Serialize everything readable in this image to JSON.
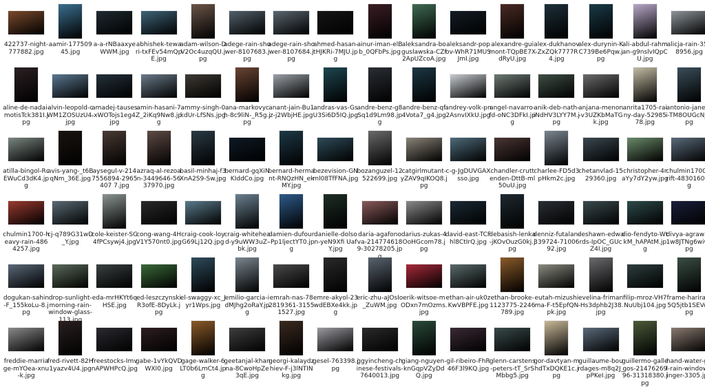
{
  "files": [
    {
      "name": "422737-night-777882.jpg",
      "color": "#7a4a2c",
      "shape": "landscape"
    },
    {
      "name": "aamir-17750945.jpg",
      "color": "#3b6e8e",
      "shape": "portrait"
    },
    {
      "name": "a-a-rNBaaxyeWWM.jpg",
      "color": "#1f2a30",
      "shape": "landscape"
    },
    {
      "name": "abhishek-tewari-txFEv54mQpE.jpg",
      "color": "#3e6478",
      "shape": "landscape"
    },
    {
      "name": "adam-wilson-DV2Oc4uzqQU.jpg",
      "color": "#6a5548",
      "shape": "portrait"
    },
    {
      "name": "adege-rain-shower-8107683.jpg",
      "color": "#52606a",
      "shape": "landscape"
    },
    {
      "name": "adege-rain-shower-8107684.jpg",
      "color": "#5a6670",
      "shape": "landscape"
    },
    {
      "name": "ahmed-hasan-tHJKRi-7MJU.jpg",
      "color": "#151515",
      "shape": "landscape"
    },
    {
      "name": "ainur-iman-elBb_0QFbPs.jpg",
      "color": "#3a1e24",
      "shape": "portrait"
    },
    {
      "name": "aleksandra-boguslawska-CZf2ApUZcoA.jpg",
      "color": "#3f6a52",
      "shape": "portrait"
    },
    {
      "name": "aleksandr-popov-WhR71MUSJmI.jpg",
      "color": "#141c24",
      "shape": "landscape"
    },
    {
      "name": "alexandre-guimont-TQpBE7XdRyU.jpg",
      "color": "#4a2a24",
      "shape": "portrait"
    },
    {
      "name": "alex-dukhanov-ZxZQk7777R4.jpg",
      "color": "#1e2f3a",
      "shape": "portrait"
    },
    {
      "name": "alex-durynin-KC739Be6Pqw.jpg",
      "color": "#1a3a46",
      "shape": "portrait"
    },
    {
      "name": "ali-abdul-rahman-g9nslvIQpCU.jpg",
      "color": "#b8a8c8",
      "shape": "portrait"
    },
    {
      "name": "alicja-rain-3518956.jpg",
      "color": "#8e949a",
      "shape": "landscape"
    },
    {
      "name": "aline-de-nadai-motisTck381I.jpg",
      "color": "#2a2022",
      "shape": "portrait"
    },
    {
      "name": "alvin-leopold-cWM1ZOSUzU4.jpg",
      "color": "#5a7890",
      "shape": "landscape"
    },
    {
      "name": "amadej-tauses-xWOTojs1eg4.jpg",
      "color": "#24303a",
      "shape": "landscape"
    },
    {
      "name": "amin-hasani-7Z_2iKq9Nw8.jpg",
      "color": "#6a7a88",
      "shape": "landscape"
    },
    {
      "name": "ammy-singh-0kdUr-LfSNs.jpg",
      "color": "#3e3a34",
      "shape": "landscape"
    },
    {
      "name": "ana-markovych-8c9liN-_R5g.jpg",
      "color": "#6a4432",
      "shape": "portrait"
    },
    {
      "name": "anant-jain-Bu1z-j2WbjHE.jpg",
      "color": "#9aa0a6",
      "shape": "landscape"
    },
    {
      "name": "andras-vas-GsU3Si6D5IQ.jpg",
      "color": "#1e4650",
      "shape": "portrait"
    },
    {
      "name": "andre-benz-g8Sq1d9Lm98.jpg",
      "color": "#2a2e34",
      "shape": "portrait"
    },
    {
      "name": "andre-benz-qf4Vota7_g4.jpg",
      "color": "#1c3844",
      "shape": "portrait"
    },
    {
      "name": "andrey-volk-pn2AsnvIXkU.jpg",
      "color": "#c8ccd0",
      "shape": "landscape"
    },
    {
      "name": "angel-navarro-fd-oNC3DFkI.jpg",
      "color": "#6e7a74",
      "shape": "landscape"
    },
    {
      "name": "anik-deb-nath-iNdHV3LYY7M.jpg",
      "color": "#3e4e44",
      "shape": "landscape"
    },
    {
      "name": "anjana-menon-v3UZKbMaTGk.jpg",
      "color": "#6c6a6a",
      "shape": "landscape"
    },
    {
      "name": "anrita1705-rainy-day-5298578.jpg",
      "color": "#c4bca4",
      "shape": "portrait"
    },
    {
      "name": "antonio-janeski-TM8OUGcNjY.jpg",
      "color": "#3a4e5a",
      "shape": "portrait"
    },
    {
      "name": "atilla-bingol-RcEWuCd3dK4.jpg",
      "color": "#7a8680",
      "shape": "landscape"
    },
    {
      "name": "avis-yang-_t6BqNm_36E.jpg",
      "color": "#1a1410",
      "shape": "portrait"
    },
    {
      "name": "aysegul-v-2147556894-2965407 7.jpg",
      "color": "#4a3a34",
      "shape": "portrait"
    },
    {
      "name": "azraq-al-rezoan-3449646-5637970.jpg",
      "color": "#5e4a44",
      "shape": "portrait"
    },
    {
      "name": "basil-minhaj-f3XnA2S9-Sw.jpg",
      "color": "#2a3a44",
      "shape": "portrait"
    },
    {
      "name": "bernard-gqXiNKIddCo.jpg",
      "color": "#0e1a24",
      "shape": "landscape"
    },
    {
      "name": "bernard-hermant-RNQzHN_ekMY.jpg",
      "color": "#1e3846",
      "shape": "portrait"
    },
    {
      "name": "bezevision-GNml08TfFNA.jpg",
      "color": "#2e4a58",
      "shape": "landscape"
    },
    {
      "name": "bozanguzel-12522699.jpg",
      "color": "#6a6a6a",
      "shape": "portrait"
    },
    {
      "name": "catgirlmutant-yZAV9qIKOQ8.jpg",
      "color": "#8a8478",
      "shape": "landscape"
    },
    {
      "name": "c-g-JgDUVGAXsso.jpg",
      "color": "#4e6a7a",
      "shape": "landscape"
    },
    {
      "name": "chandler-cruttenden-DttB-ml50uU.jpg",
      "color": "#4a3634",
      "shape": "landscape"
    },
    {
      "name": "charlee-FD5d3pHkm2c.jpg",
      "color": "#7a8690",
      "shape": "portrait"
    },
    {
      "name": "chetanvlad-1529360.jpg",
      "color": "#3a4850",
      "shape": "landscape"
    },
    {
      "name": "christopher-4raYy7dY2yw.jpg",
      "color": "#6a8a6a",
      "shape": "landscape"
    },
    {
      "name": "chulmin1700-drift-4830160.jpg",
      "color": "#5a6a7a",
      "shape": "landscape"
    },
    {
      "name": "chulmin1700-heavy-rain-4864257.jpg",
      "color": "#9a3a30",
      "shape": "landscape"
    },
    {
      "name": "cj-q789G31wD_Y.jpg",
      "color": "#5a6a74",
      "shape": "landscape"
    },
    {
      "name": "cole-keister-SG4fPCsywj4.jpg",
      "color": "#8a9490",
      "shape": "portrait"
    },
    {
      "name": "cong-wang-4HV1Y570nt0.jpg",
      "color": "#2a2a2a",
      "shape": "landscape"
    },
    {
      "name": "craig-cook-loyG69Lj12Q.jpg",
      "color": "#5a7a8a",
      "shape": "landscape"
    },
    {
      "name": "craig-whitehead-y9uWW3uZ-bk.jpg",
      "color": "#6a8090",
      "shape": "portrait"
    },
    {
      "name": "damien-dufour-Pp1ljectYT0.jpg",
      "color": "#2e5a88",
      "shape": "portrait"
    },
    {
      "name": "danielle-dolson-yeN9Xfi UafY.jpg",
      "color": "#1e2e26",
      "shape": "portrait"
    },
    {
      "name": "daria-agafonova-2147746189-30278205.jpg",
      "color": "#8a5a5a",
      "shape": "landscape"
    },
    {
      "name": "darius-zukas-4OoHGcom78.jpg",
      "color": "#8a8a8a",
      "shape": "landscape"
    },
    {
      "name": "david-east-TCFhl8CtIrQ.jpg",
      "color": "#1a2a34",
      "shape": "landscape"
    },
    {
      "name": "debasish-lenka-jKOvOuzG0kj.jpg",
      "color": "#1e2a30",
      "shape": "portrait"
    },
    {
      "name": "denniz-futalan-339724-7100692.jpg",
      "color": "#2a2e34",
      "shape": "landscape"
    },
    {
      "name": "deshawn-edwards-IpOC_GUcZ4I.jpg",
      "color": "#3a4a4e",
      "shape": "landscape"
    },
    {
      "name": "dio-fendyto-WtkM_hAPAtM.jpg",
      "color": "#2e4a4a",
      "shape": "landscape"
    },
    {
      "name": "divya-agrawal-1w8JTNg6wiw.jpg",
      "color": "#1a1e3a",
      "shape": "landscape"
    },
    {
      "name": "dogukan-sahin-F_155koLu-8.jpg",
      "color": "#5a6878",
      "shape": "landscape"
    },
    {
      "name": "drop-sunlight-morning-rain-window-glass-113.jpg",
      "color": "#5a6a5a",
      "shape": "landscape"
    },
    {
      "name": "eda-mrHKYt6qHSE.jpg",
      "color": "#3a4040",
      "shape": "landscape"
    },
    {
      "name": "ed-leszczynskiR3ofE-8DyLk.jpg",
      "color": "#3a6a3a",
      "shape": "landscape"
    },
    {
      "name": "el-swaggy-xc_Jyr1Wps.jpg",
      "color": "#2e4a5a",
      "shape": "portrait"
    },
    {
      "name": "emilio-garcia-idMJhg2oRaY.jpg",
      "color": "#7a8690",
      "shape": "portrait"
    },
    {
      "name": "emrah-nas-782819361-31551527.jpg",
      "color": "#4a4a4a",
      "shape": "landscape"
    },
    {
      "name": "emre-akyol-23wdEBXe4kk.jpg",
      "color": "#2a2a2a",
      "shape": "portrait"
    },
    {
      "name": "eric-zhu-aJOsIo_ZuWM.jpg",
      "color": "#5a6470",
      "shape": "portrait"
    },
    {
      "name": "erik-witsoe-mODxn7mOzms.jpg",
      "color": "#a82a3a",
      "shape": "landscape"
    },
    {
      "name": "ethan-air-uk0zKwVBPFE.jpg",
      "color": "#5a6a6a",
      "shape": "landscape"
    },
    {
      "name": "ethan-brooke-1123775-2246789.jpg",
      "color": "#8a5a2a",
      "shape": "portrait"
    },
    {
      "name": "eutah-mizushima-F-t5EpfQNpk.jpg",
      "color": "#8a8a80",
      "shape": "landscape"
    },
    {
      "name": "evelina-friman-Hs3dphb2J38.jpg",
      "color": "#6a6a6e",
      "shape": "portrait"
    },
    {
      "name": "filip-mroz-VH7NuUbj104.jpg",
      "color": "#2e3e3e",
      "shape": "landscape"
    },
    {
      "name": "frame-harirak-5Q5jtb1SEVo.jpg",
      "color": "#3a4e44",
      "shape": "portrait"
    },
    {
      "name": "freddie-marriage-mYOea-xnu-k.jpg",
      "color": "#8a8a8a",
      "shape": "landscape"
    },
    {
      "name": "fred-rivett-82H1yazv4U4.jpg",
      "color": "#2a2020",
      "shape": "portrait"
    },
    {
      "name": "freestocks-ImvnAPWHPcQ.jpg",
      "color": "#2a2a30",
      "shape": "landscape"
    },
    {
      "name": "gabe-1vYkQVDWXI0.jpg",
      "color": "#2e1e20",
      "shape": "landscape"
    },
    {
      "name": "gage-walker-6LT0b6LmCt4.jpg",
      "color": "#8a5a2a",
      "shape": "portrait"
    },
    {
      "name": "geetanjal-khanna-8CwoHpZe3qE.jpg",
      "color": "#3e3e3e",
      "shape": "landscape"
    },
    {
      "name": "georgi-kalaydzhiev-F-j3lNTINkg.jpg",
      "color": "#3a2a20",
      "shape": "portrait"
    },
    {
      "name": "gesel-763398.jpg",
      "color": "#9a9aa0",
      "shape": "landscape"
    },
    {
      "name": "ggyincheng-chinese-festivals-7640013.jpg",
      "color": "#2a2a2a",
      "shape": "landscape"
    },
    {
      "name": "giang-nguyen-knGqpVZyDdQ.jpg",
      "color": "#2a4a3a",
      "shape": "portrait"
    },
    {
      "name": "gil-ribeiro-FhR46F3l9KQ.jpg",
      "color": "#3a2a34",
      "shape": "landscape"
    },
    {
      "name": "glenn-carstens-peters-tT_SrSMbbg5.jpg",
      "color": "#3a4a4a",
      "shape": "landscape"
    },
    {
      "name": "gor-davtyan-mhdTxDQKE1c.jpg",
      "color": "#c8b898",
      "shape": "portrait"
    },
    {
      "name": "guillaume-bourdages-m8q2J_pPKeI.jpg",
      "color": "#5a6a7a",
      "shape": "landscape"
    },
    {
      "name": "guillermo-gallegos-2147626996-31318380.jpg",
      "color": "#4a5a3a",
      "shape": "portrait"
    },
    {
      "name": "hand-water-girl-rain-window-finger-3305.jpg",
      "color": "#8a7a70",
      "shape": "landscape"
    }
  ]
}
